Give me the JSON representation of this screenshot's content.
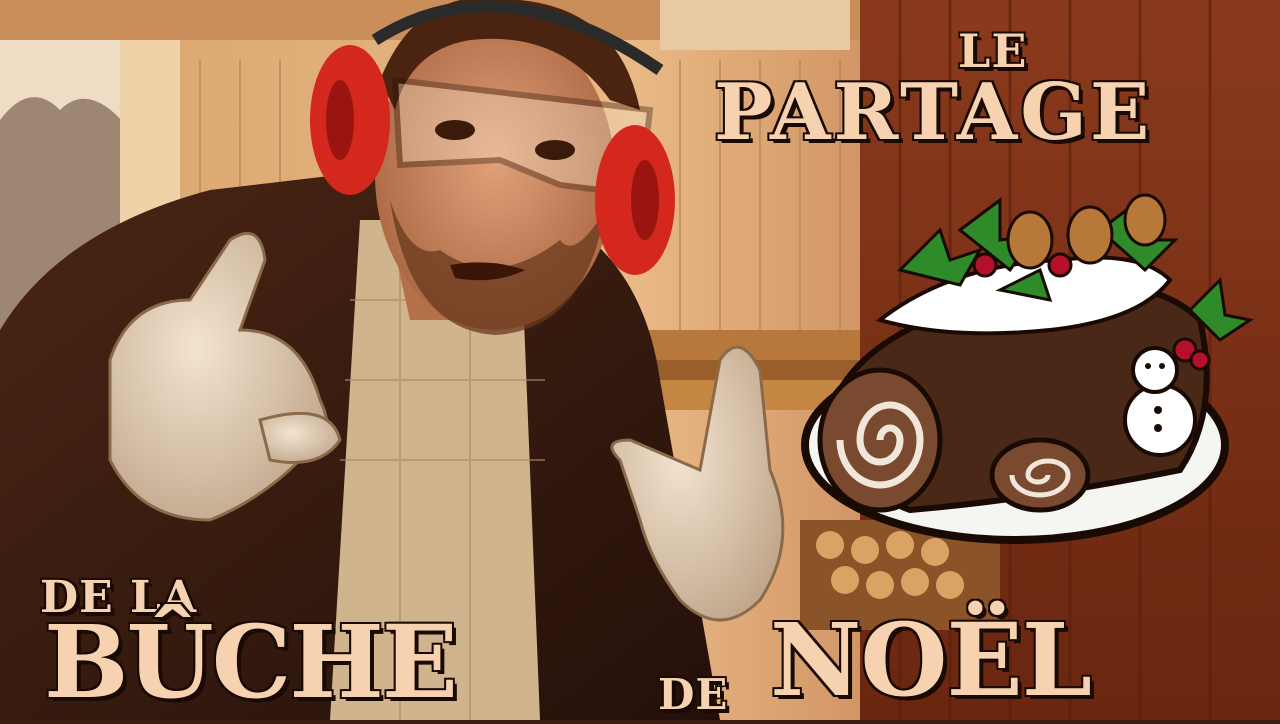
{
  "title": {
    "line1": "LE",
    "line2": "PARTAGE",
    "line3": "DE LA",
    "line4_word1": "BÛCHE",
    "line4_connector": "DE",
    "line4_word2": "NOËL"
  },
  "colors": {
    "title_fill": "#f6d2b0",
    "title_outline": "#1a0a04",
    "ear_muffs": "#d4281e",
    "log_cake": "#4a2818",
    "holly": "#2f8a2a",
    "berries": "#b4102a"
  },
  "illustration": {
    "subject": "yule-log-cake-icon"
  }
}
